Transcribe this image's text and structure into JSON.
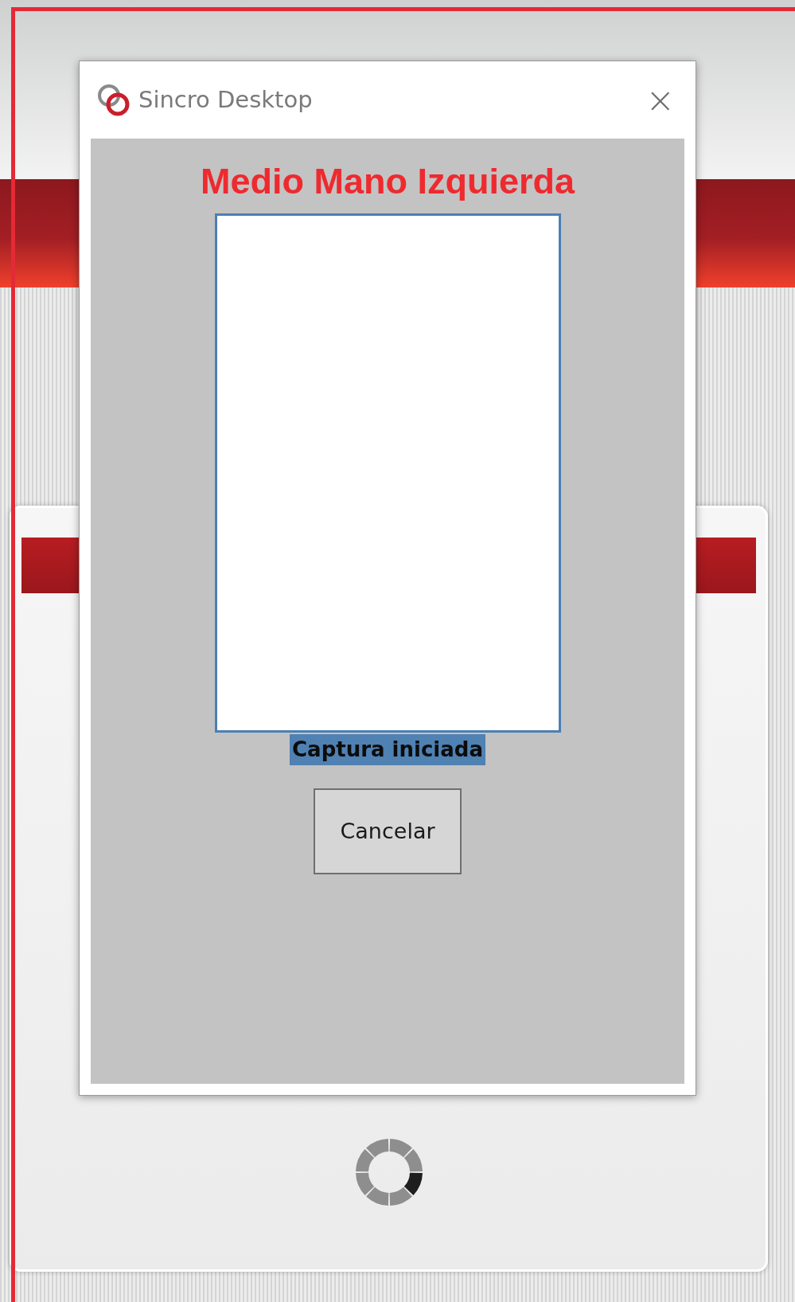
{
  "window": {
    "title": "Sincro Desktop",
    "close": "×"
  },
  "heading": "Medio Mano Izquierda",
  "status": "Captura iniciada",
  "buttons": [
    "Cancelar"
  ]
}
